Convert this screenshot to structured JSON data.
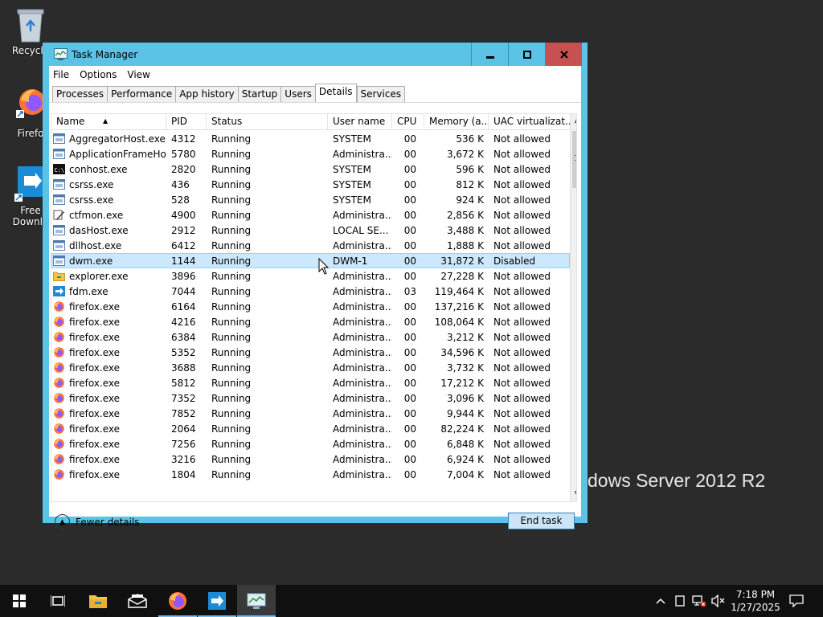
{
  "desktop": {
    "icons": [
      {
        "label": "Recycle"
      },
      {
        "label": "Firefo"
      },
      {
        "label": "Free Downlo"
      }
    ],
    "watermark": "dows Server 2012 R2"
  },
  "window": {
    "title": "Task Manager",
    "menu": [
      "File",
      "Options",
      "View"
    ],
    "tabs": [
      "Processes",
      "Performance",
      "App history",
      "Startup",
      "Users",
      "Details",
      "Services"
    ],
    "active_tab": "Details",
    "columns": [
      "Name",
      "PID",
      "Status",
      "User name",
      "CPU",
      "Memory (a...",
      "UAC virtualizat..."
    ],
    "rows": [
      {
        "icon": "app",
        "name": "AggregatorHost.exe",
        "pid": "4312",
        "status": "Running",
        "user": "SYSTEM",
        "cpu": "00",
        "mem": "536 K",
        "uac": "Not allowed"
      },
      {
        "icon": "app",
        "name": "ApplicationFrameHo...",
        "pid": "5780",
        "status": "Running",
        "user": "Administra...",
        "cpu": "00",
        "mem": "3,672 K",
        "uac": "Not allowed"
      },
      {
        "icon": "console",
        "name": "conhost.exe",
        "pid": "2820",
        "status": "Running",
        "user": "SYSTEM",
        "cpu": "00",
        "mem": "596 K",
        "uac": "Not allowed"
      },
      {
        "icon": "app",
        "name": "csrss.exe",
        "pid": "436",
        "status": "Running",
        "user": "SYSTEM",
        "cpu": "00",
        "mem": "812 K",
        "uac": "Not allowed"
      },
      {
        "icon": "app",
        "name": "csrss.exe",
        "pid": "528",
        "status": "Running",
        "user": "SYSTEM",
        "cpu": "00",
        "mem": "924 K",
        "uac": "Not allowed"
      },
      {
        "icon": "pen",
        "name": "ctfmon.exe",
        "pid": "4900",
        "status": "Running",
        "user": "Administra...",
        "cpu": "00",
        "mem": "2,856 K",
        "uac": "Not allowed"
      },
      {
        "icon": "app",
        "name": "dasHost.exe",
        "pid": "2912",
        "status": "Running",
        "user": "LOCAL SE...",
        "cpu": "00",
        "mem": "3,488 K",
        "uac": "Not allowed"
      },
      {
        "icon": "app",
        "name": "dllhost.exe",
        "pid": "6412",
        "status": "Running",
        "user": "Administra...",
        "cpu": "00",
        "mem": "1,888 K",
        "uac": "Not allowed"
      },
      {
        "icon": "app",
        "name": "dwm.exe",
        "pid": "1144",
        "status": "Running",
        "user": "DWM-1",
        "cpu": "00",
        "mem": "31,872 K",
        "uac": "Disabled",
        "selected": true
      },
      {
        "icon": "folder",
        "name": "explorer.exe",
        "pid": "3896",
        "status": "Running",
        "user": "Administra...",
        "cpu": "00",
        "mem": "27,228 K",
        "uac": "Not allowed"
      },
      {
        "icon": "fdm",
        "name": "fdm.exe",
        "pid": "7044",
        "status": "Running",
        "user": "Administra...",
        "cpu": "03",
        "mem": "119,464 K",
        "uac": "Not allowed"
      },
      {
        "icon": "firefox",
        "name": "firefox.exe",
        "pid": "6164",
        "status": "Running",
        "user": "Administra...",
        "cpu": "00",
        "mem": "137,216 K",
        "uac": "Not allowed"
      },
      {
        "icon": "firefox",
        "name": "firefox.exe",
        "pid": "4216",
        "status": "Running",
        "user": "Administra...",
        "cpu": "00",
        "mem": "108,064 K",
        "uac": "Not allowed"
      },
      {
        "icon": "firefox",
        "name": "firefox.exe",
        "pid": "6384",
        "status": "Running",
        "user": "Administra...",
        "cpu": "00",
        "mem": "3,212 K",
        "uac": "Not allowed"
      },
      {
        "icon": "firefox",
        "name": "firefox.exe",
        "pid": "5352",
        "status": "Running",
        "user": "Administra...",
        "cpu": "00",
        "mem": "34,596 K",
        "uac": "Not allowed"
      },
      {
        "icon": "firefox",
        "name": "firefox.exe",
        "pid": "3688",
        "status": "Running",
        "user": "Administra...",
        "cpu": "00",
        "mem": "3,732 K",
        "uac": "Not allowed"
      },
      {
        "icon": "firefox",
        "name": "firefox.exe",
        "pid": "5812",
        "status": "Running",
        "user": "Administra...",
        "cpu": "00",
        "mem": "17,212 K",
        "uac": "Not allowed"
      },
      {
        "icon": "firefox",
        "name": "firefox.exe",
        "pid": "7352",
        "status": "Running",
        "user": "Administra...",
        "cpu": "00",
        "mem": "3,096 K",
        "uac": "Not allowed"
      },
      {
        "icon": "firefox",
        "name": "firefox.exe",
        "pid": "7852",
        "status": "Running",
        "user": "Administra...",
        "cpu": "00",
        "mem": "9,944 K",
        "uac": "Not allowed"
      },
      {
        "icon": "firefox",
        "name": "firefox.exe",
        "pid": "2064",
        "status": "Running",
        "user": "Administra...",
        "cpu": "00",
        "mem": "82,224 K",
        "uac": "Not allowed"
      },
      {
        "icon": "firefox",
        "name": "firefox.exe",
        "pid": "7256",
        "status": "Running",
        "user": "Administra...",
        "cpu": "00",
        "mem": "6,848 K",
        "uac": "Not allowed"
      },
      {
        "icon": "firefox",
        "name": "firefox.exe",
        "pid": "3216",
        "status": "Running",
        "user": "Administra...",
        "cpu": "00",
        "mem": "6,924 K",
        "uac": "Not allowed"
      },
      {
        "icon": "firefox",
        "name": "firefox.exe",
        "pid": "1804",
        "status": "Running",
        "user": "Administra...",
        "cpu": "00",
        "mem": "7,004 K",
        "uac": "Not allowed"
      }
    ],
    "fewer_details": "Fewer details",
    "end_task": "End task"
  },
  "taskbar": {
    "clock_time": "7:18 PM",
    "clock_date": "1/27/2025"
  },
  "colors": {
    "title_bar": "#5ac3e6",
    "close_button": "#c75050",
    "selection": "#cce8ff",
    "taskbar": "#101010"
  }
}
